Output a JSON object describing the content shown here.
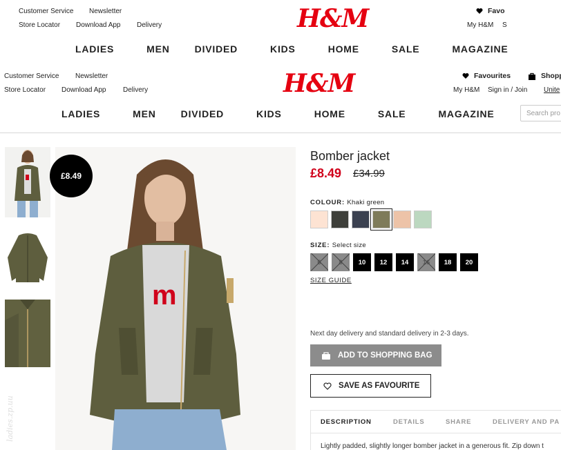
{
  "ghost_header": {
    "util_links": [
      "Customer Service",
      "Newsletter",
      "Store Locator",
      "Download App",
      "Delivery"
    ],
    "logo": "H&M",
    "favourites_label": "Favo",
    "account_links": [
      "My H&M",
      "S"
    ],
    "nav": [
      "LADIES",
      "MEN",
      "DIVIDED",
      "KIDS",
      "HOME",
      "SALE",
      "MAGAZINE"
    ]
  },
  "header": {
    "util_links": [
      "Customer Service",
      "Newsletter",
      "Store Locator",
      "Download App",
      "Delivery"
    ],
    "logo": "H&M",
    "favourites_label": "Favourites",
    "shopping_label": "Shopp",
    "account_links": [
      "My H&M",
      "Sign in / Join",
      "Unite"
    ],
    "search_placeholder": "Search pro",
    "nav": [
      "LADIES",
      "MEN",
      "DIVIDED",
      "KIDS",
      "HOME",
      "SALE",
      "MAGAZINE"
    ]
  },
  "product": {
    "badge_price": "£8.49",
    "title": "Bomber jacket",
    "price": "£8.49",
    "old_price": "£34.99",
    "colour_label": "COLOUR:",
    "colour_value": "Khaki green",
    "swatches": [
      "#fde3d3",
      "#3e3f3a",
      "#3b4150",
      "#7e7b5a",
      "#edc3a8",
      "#bcd8c0"
    ],
    "selected_swatch_index": 3,
    "size_label": "SIZE:",
    "size_value": "Select size",
    "sizes": [
      {
        "label": "6",
        "available": false
      },
      {
        "label": "8",
        "available": false
      },
      {
        "label": "10",
        "available": true
      },
      {
        "label": "12",
        "available": true
      },
      {
        "label": "14",
        "available": true
      },
      {
        "label": "16",
        "available": false
      },
      {
        "label": "18",
        "available": true
      },
      {
        "label": "20",
        "available": true
      }
    ],
    "size_guide": "SIZE GUIDE",
    "delivery_text": "Next day delivery and standard delivery in 2-3 days.",
    "add_to_bag": "ADD TO SHOPPING BAG",
    "save_favourite": "SAVE AS FAVOURITE",
    "tabs": [
      "DESCRIPTION",
      "DETAILS",
      "SHARE",
      "DELIVERY AND PA"
    ],
    "description": "Lightly padded, slightly longer bomber jacket in a generous fit. Zip down t",
    "watermark": "ladies.zp.uu"
  },
  "colors": {
    "brand_red": "#e50010",
    "sale_price": "#d0021b",
    "jacket": "#5e5e3e"
  }
}
